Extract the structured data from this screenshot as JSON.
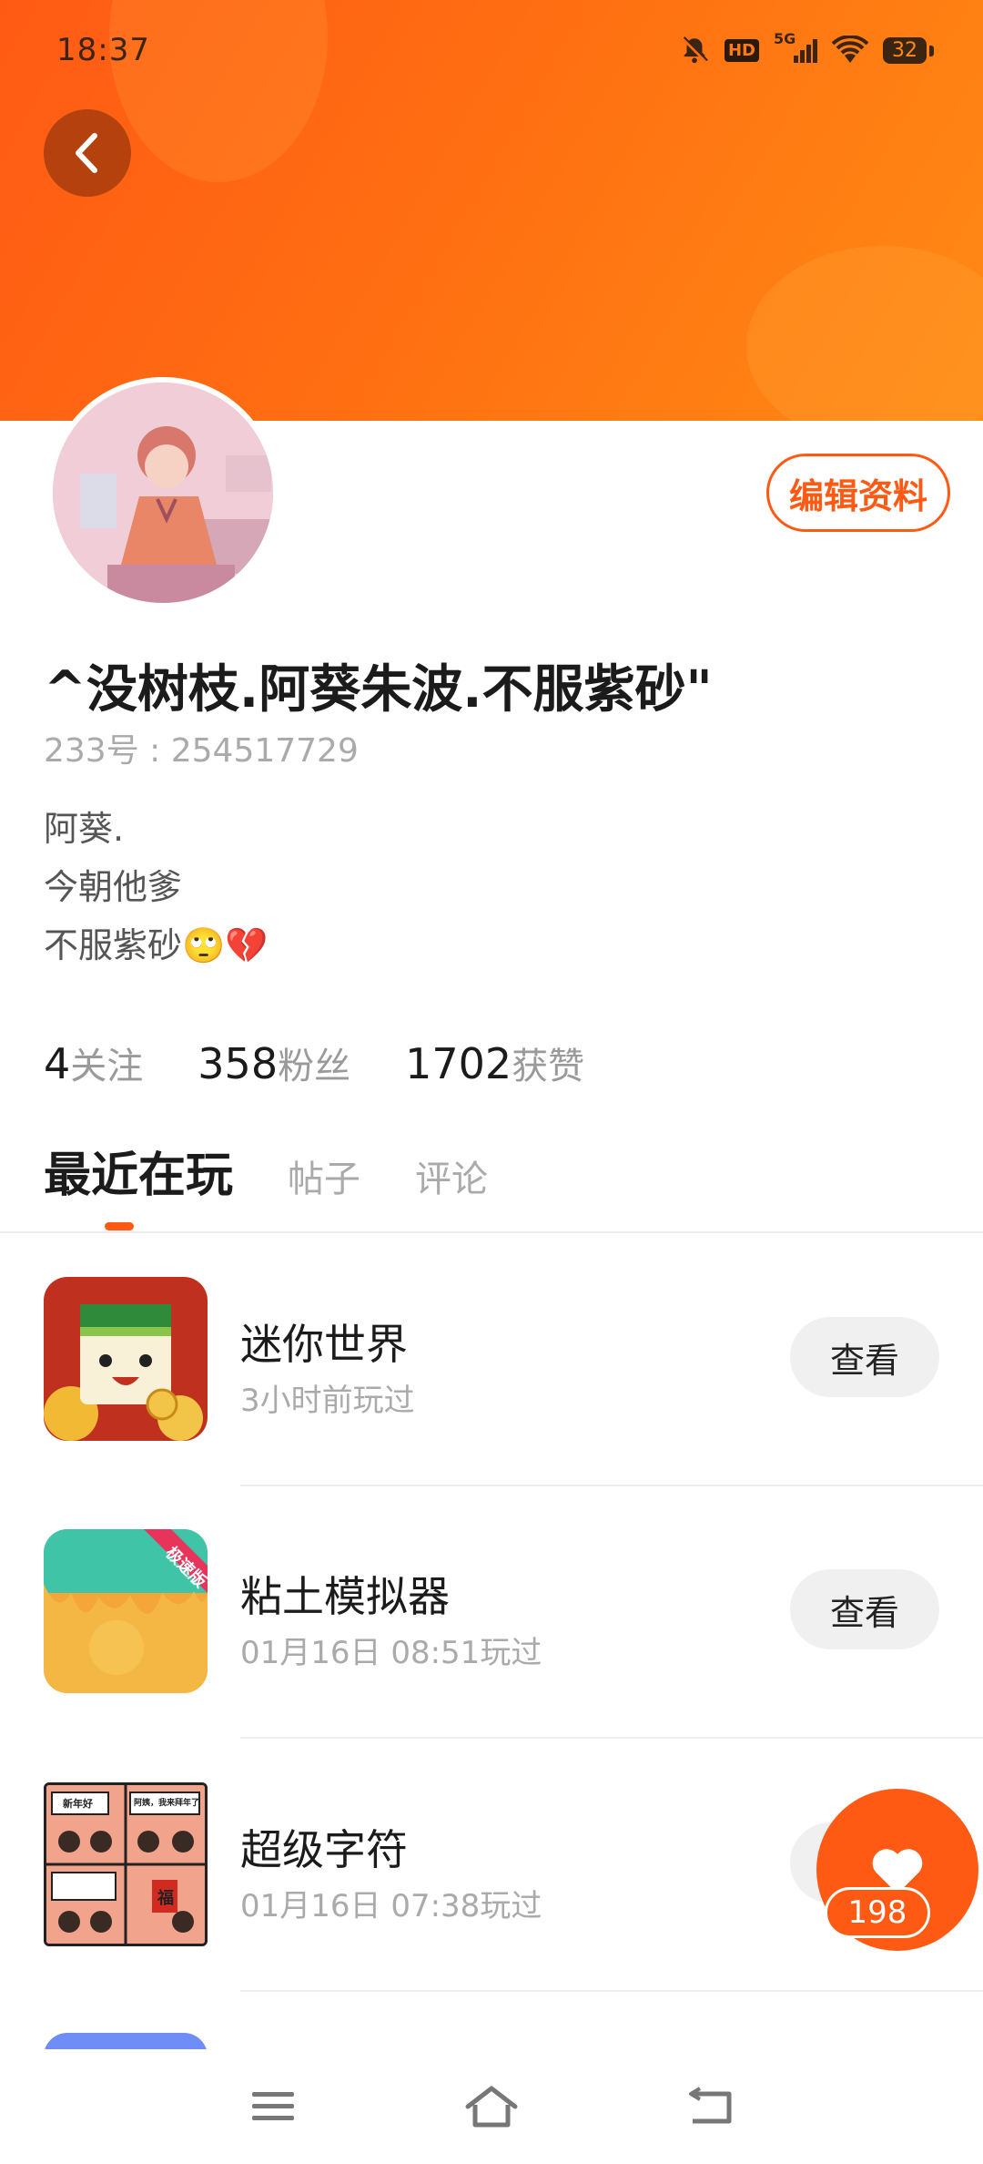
{
  "status_bar": {
    "time": "18:37",
    "network": "5G",
    "hd_label": "HD",
    "battery": "32",
    "icons": [
      "bell-muted-icon",
      "hd-icon",
      "signal-icon",
      "wifi-icon",
      "battery-icon"
    ]
  },
  "header": {
    "back_icon": "chevron-left-icon",
    "banner_color": "#ff6e12"
  },
  "profile": {
    "edit_label": "编辑资料",
    "nickname": "^没树枝.阿葵朱波.不服紫砂\"",
    "uid": "233号 : 254517729",
    "bio_lines": [
      "阿葵.",
      "今朝他爹",
      "不服紫砂🙄💔"
    ]
  },
  "stats": [
    {
      "num": "4",
      "label": "关注"
    },
    {
      "num": "358",
      "label": "粉丝"
    },
    {
      "num": "1702",
      "label": "获赞"
    }
  ],
  "tabs": [
    {
      "label": "最近在玩",
      "active": true
    },
    {
      "label": "帖子",
      "active": false
    },
    {
      "label": "评论",
      "active": false
    }
  ],
  "games": [
    {
      "title": "迷你世界",
      "subtitle": "3小时前玩过",
      "button": "查看"
    },
    {
      "title": "粘土模拟器",
      "subtitle": "01月16日 08:51玩过",
      "button": "查看",
      "badge": "极速版"
    },
    {
      "title": "超级字符",
      "subtitle": "01月16日 07:38玩过",
      "button": "查看"
    }
  ],
  "comic_texts": [
    "新年好",
    "阿姨，我来拜年了",
    "福"
  ],
  "like_fab": {
    "count": "198",
    "icon": "heart-icon"
  },
  "nav": {
    "icons": [
      "menu-icon",
      "home-icon",
      "back-icon"
    ]
  },
  "colors": {
    "accent": "#ff5a14"
  }
}
